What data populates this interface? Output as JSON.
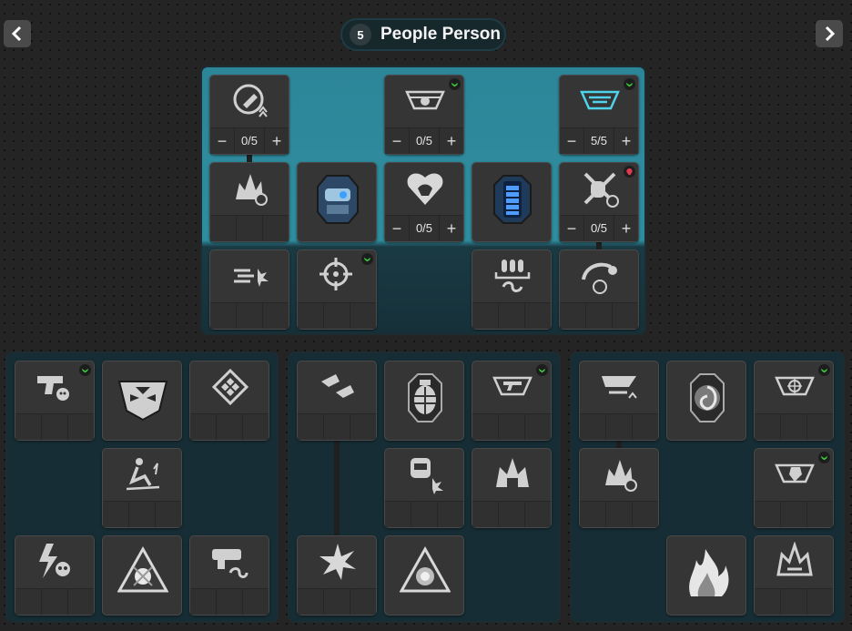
{
  "header": {
    "tree_number": "5",
    "tree_title": "People Person"
  },
  "colors": {
    "background": "#242424",
    "main_panel_top": "#2f8da0",
    "panel": "#162d35",
    "tile": "#353535",
    "mark_green": "#3ad13a",
    "mark_red": "#e0394f"
  },
  "main_tree": {
    "row1": [
      {
        "icon": "reload-arrow-icon",
        "counter": "0/5"
      },
      {
        "icon": "emblem-wings-icon",
        "counter": "0/5",
        "mark": "green"
      },
      {
        "icon": "wings-bullets-icon",
        "counter": "5/5",
        "mark": "green"
      }
    ],
    "row2": [
      {
        "icon": "burst-timer-icon"
      },
      {
        "icon": "turret-robot-icon"
      },
      {
        "icon": "heart-muscle-icon",
        "counter": "0/5"
      },
      {
        "icon": "battery-shield-icon"
      },
      {
        "icon": "grenade-knife-icon",
        "counter": "0/5",
        "mark": "red"
      }
    ],
    "row3": [
      {
        "icon": "bullet-burst-icon"
      },
      {
        "icon": "crosshair-icon",
        "mark": "green"
      },
      {
        "icon": "ammo-refill-icon"
      },
      {
        "icon": "grenade-timer-icon"
      }
    ]
  },
  "sub_trees": [
    {
      "tiles": [
        {
          "icon": "pistol-skull-icon",
          "mark": "green"
        },
        {
          "icon": "wings-mask-icon"
        },
        {
          "icon": "cracked-diamond-icon"
        },
        {
          "icon": "slip-fall-icon"
        },
        {
          "icon": "lightning-skull-icon"
        },
        {
          "icon": "shattered-triangle-icon"
        },
        {
          "icon": "gun-recycle-icon"
        }
      ]
    },
    {
      "tiles": [
        {
          "icon": "flying-blades-icon"
        },
        {
          "icon": "grenade-icon"
        },
        {
          "icon": "wings-gun-icon",
          "mark": "green"
        },
        {
          "icon": "robot-burst-icon"
        },
        {
          "icon": "explosion-icon"
        },
        {
          "icon": "starburst-icon"
        },
        {
          "icon": "shattered-orb-icon"
        }
      ]
    },
    {
      "tiles": [
        {
          "icon": "blades-up-icon"
        },
        {
          "icon": "swirl-orb-icon"
        },
        {
          "icon": "wings-crosshair-icon",
          "mark": "green"
        },
        {
          "icon": "burst-timer-icon"
        },
        {
          "icon": "wings-shield-icon",
          "mark": "green"
        },
        {
          "icon": "flame-icon"
        },
        {
          "icon": "crown-burst-icon"
        }
      ]
    }
  ]
}
